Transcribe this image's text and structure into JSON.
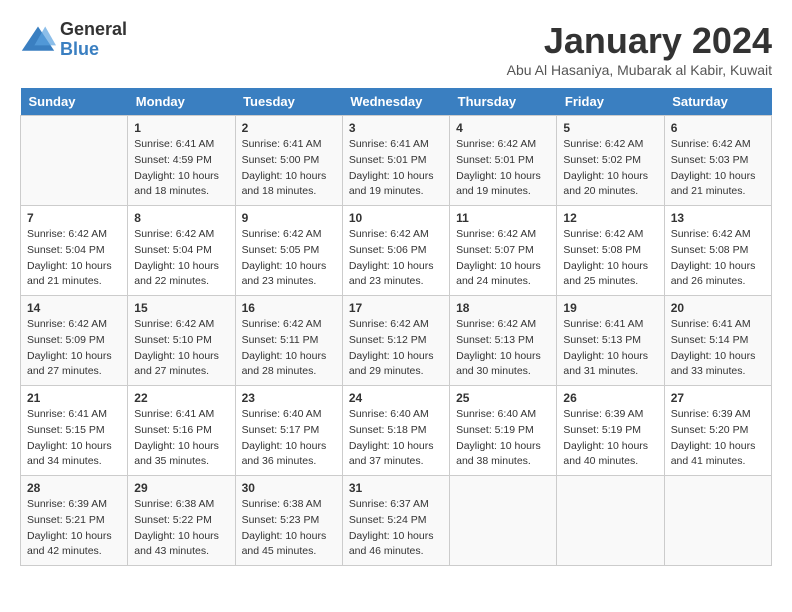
{
  "logo": {
    "general": "General",
    "blue": "Blue"
  },
  "calendar": {
    "title": "January 2024",
    "subtitle": "Abu Al Hasaniya, Mubarak al Kabir, Kuwait"
  },
  "headers": [
    "Sunday",
    "Monday",
    "Tuesday",
    "Wednesday",
    "Thursday",
    "Friday",
    "Saturday"
  ],
  "weeks": [
    [
      {
        "day": "",
        "sunrise": "",
        "sunset": "",
        "daylight": ""
      },
      {
        "day": "1",
        "sunrise": "Sunrise: 6:41 AM",
        "sunset": "Sunset: 4:59 PM",
        "daylight": "Daylight: 10 hours and 18 minutes."
      },
      {
        "day": "2",
        "sunrise": "Sunrise: 6:41 AM",
        "sunset": "Sunset: 5:00 PM",
        "daylight": "Daylight: 10 hours and 18 minutes."
      },
      {
        "day": "3",
        "sunrise": "Sunrise: 6:41 AM",
        "sunset": "Sunset: 5:01 PM",
        "daylight": "Daylight: 10 hours and 19 minutes."
      },
      {
        "day": "4",
        "sunrise": "Sunrise: 6:42 AM",
        "sunset": "Sunset: 5:01 PM",
        "daylight": "Daylight: 10 hours and 19 minutes."
      },
      {
        "day": "5",
        "sunrise": "Sunrise: 6:42 AM",
        "sunset": "Sunset: 5:02 PM",
        "daylight": "Daylight: 10 hours and 20 minutes."
      },
      {
        "day": "6",
        "sunrise": "Sunrise: 6:42 AM",
        "sunset": "Sunset: 5:03 PM",
        "daylight": "Daylight: 10 hours and 21 minutes."
      }
    ],
    [
      {
        "day": "7",
        "sunrise": "Sunrise: 6:42 AM",
        "sunset": "Sunset: 5:04 PM",
        "daylight": "Daylight: 10 hours and 21 minutes."
      },
      {
        "day": "8",
        "sunrise": "Sunrise: 6:42 AM",
        "sunset": "Sunset: 5:04 PM",
        "daylight": "Daylight: 10 hours and 22 minutes."
      },
      {
        "day": "9",
        "sunrise": "Sunrise: 6:42 AM",
        "sunset": "Sunset: 5:05 PM",
        "daylight": "Daylight: 10 hours and 23 minutes."
      },
      {
        "day": "10",
        "sunrise": "Sunrise: 6:42 AM",
        "sunset": "Sunset: 5:06 PM",
        "daylight": "Daylight: 10 hours and 23 minutes."
      },
      {
        "day": "11",
        "sunrise": "Sunrise: 6:42 AM",
        "sunset": "Sunset: 5:07 PM",
        "daylight": "Daylight: 10 hours and 24 minutes."
      },
      {
        "day": "12",
        "sunrise": "Sunrise: 6:42 AM",
        "sunset": "Sunset: 5:08 PM",
        "daylight": "Daylight: 10 hours and 25 minutes."
      },
      {
        "day": "13",
        "sunrise": "Sunrise: 6:42 AM",
        "sunset": "Sunset: 5:08 PM",
        "daylight": "Daylight: 10 hours and 26 minutes."
      }
    ],
    [
      {
        "day": "14",
        "sunrise": "Sunrise: 6:42 AM",
        "sunset": "Sunset: 5:09 PM",
        "daylight": "Daylight: 10 hours and 27 minutes."
      },
      {
        "day": "15",
        "sunrise": "Sunrise: 6:42 AM",
        "sunset": "Sunset: 5:10 PM",
        "daylight": "Daylight: 10 hours and 27 minutes."
      },
      {
        "day": "16",
        "sunrise": "Sunrise: 6:42 AM",
        "sunset": "Sunset: 5:11 PM",
        "daylight": "Daylight: 10 hours and 28 minutes."
      },
      {
        "day": "17",
        "sunrise": "Sunrise: 6:42 AM",
        "sunset": "Sunset: 5:12 PM",
        "daylight": "Daylight: 10 hours and 29 minutes."
      },
      {
        "day": "18",
        "sunrise": "Sunrise: 6:42 AM",
        "sunset": "Sunset: 5:13 PM",
        "daylight": "Daylight: 10 hours and 30 minutes."
      },
      {
        "day": "19",
        "sunrise": "Sunrise: 6:41 AM",
        "sunset": "Sunset: 5:13 PM",
        "daylight": "Daylight: 10 hours and 31 minutes."
      },
      {
        "day": "20",
        "sunrise": "Sunrise: 6:41 AM",
        "sunset": "Sunset: 5:14 PM",
        "daylight": "Daylight: 10 hours and 33 minutes."
      }
    ],
    [
      {
        "day": "21",
        "sunrise": "Sunrise: 6:41 AM",
        "sunset": "Sunset: 5:15 PM",
        "daylight": "Daylight: 10 hours and 34 minutes."
      },
      {
        "day": "22",
        "sunrise": "Sunrise: 6:41 AM",
        "sunset": "Sunset: 5:16 PM",
        "daylight": "Daylight: 10 hours and 35 minutes."
      },
      {
        "day": "23",
        "sunrise": "Sunrise: 6:40 AM",
        "sunset": "Sunset: 5:17 PM",
        "daylight": "Daylight: 10 hours and 36 minutes."
      },
      {
        "day": "24",
        "sunrise": "Sunrise: 6:40 AM",
        "sunset": "Sunset: 5:18 PM",
        "daylight": "Daylight: 10 hours and 37 minutes."
      },
      {
        "day": "25",
        "sunrise": "Sunrise: 6:40 AM",
        "sunset": "Sunset: 5:19 PM",
        "daylight": "Daylight: 10 hours and 38 minutes."
      },
      {
        "day": "26",
        "sunrise": "Sunrise: 6:39 AM",
        "sunset": "Sunset: 5:19 PM",
        "daylight": "Daylight: 10 hours and 40 minutes."
      },
      {
        "day": "27",
        "sunrise": "Sunrise: 6:39 AM",
        "sunset": "Sunset: 5:20 PM",
        "daylight": "Daylight: 10 hours and 41 minutes."
      }
    ],
    [
      {
        "day": "28",
        "sunrise": "Sunrise: 6:39 AM",
        "sunset": "Sunset: 5:21 PM",
        "daylight": "Daylight: 10 hours and 42 minutes."
      },
      {
        "day": "29",
        "sunrise": "Sunrise: 6:38 AM",
        "sunset": "Sunset: 5:22 PM",
        "daylight": "Daylight: 10 hours and 43 minutes."
      },
      {
        "day": "30",
        "sunrise": "Sunrise: 6:38 AM",
        "sunset": "Sunset: 5:23 PM",
        "daylight": "Daylight: 10 hours and 45 minutes."
      },
      {
        "day": "31",
        "sunrise": "Sunrise: 6:37 AM",
        "sunset": "Sunset: 5:24 PM",
        "daylight": "Daylight: 10 hours and 46 minutes."
      },
      {
        "day": "",
        "sunrise": "",
        "sunset": "",
        "daylight": ""
      },
      {
        "day": "",
        "sunrise": "",
        "sunset": "",
        "daylight": ""
      },
      {
        "day": "",
        "sunrise": "",
        "sunset": "",
        "daylight": ""
      }
    ]
  ]
}
